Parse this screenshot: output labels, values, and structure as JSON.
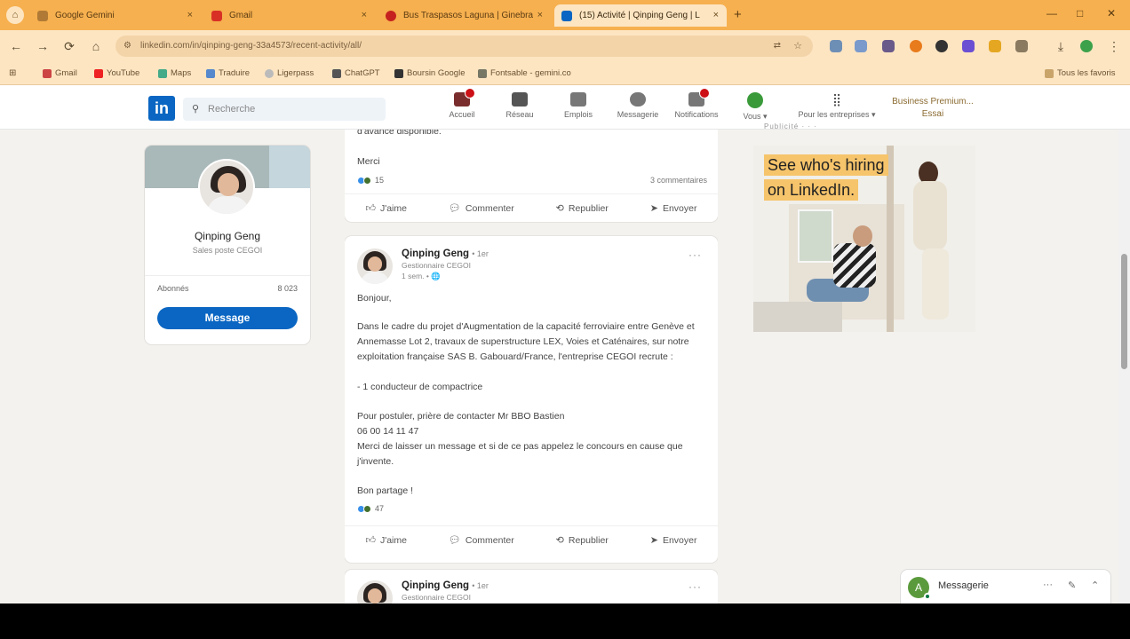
{
  "browser": {
    "tabs": [
      {
        "title": "Google Gemini",
        "color": "#8a6a30"
      },
      {
        "title": "Gmail",
        "color": "#d93025"
      },
      {
        "title": "Bus Traspasos Laguna | Ginebra",
        "color": "#c5221f"
      },
      {
        "title": "(15) Activité | Qinping Geng | L",
        "color": "#0a66c2"
      }
    ],
    "new_tab_label": "+",
    "close_glyph": "×",
    "window_controls": [
      "—",
      "□",
      "✕"
    ],
    "address": "linkedin.com/in/qinping-geng-33a4573/recent-activity/all/",
    "bookmarks": [
      {
        "label": "Gmail",
        "icon": "mail-icon"
      },
      {
        "label": "YouTube",
        "icon": "youtube-icon"
      },
      {
        "label": "Maps",
        "icon": "map-pin-icon"
      },
      {
        "label": "Traduire",
        "icon": "translate-icon"
      },
      {
        "label": "Ligerpass",
        "icon": "globe-icon"
      },
      {
        "label": "ChatGPT",
        "icon": "chat-icon"
      },
      {
        "label": "Boursin Google",
        "icon": "bookmark-icon"
      },
      {
        "label": "Fontsable - gemini.co",
        "icon": "folder-icon"
      }
    ],
    "all_bookmarks": "Tous les favoris",
    "nav_glyphs": {
      "back": "←",
      "forward": "→",
      "reload": "⟳",
      "home": "⌂",
      "download": "⤓"
    }
  },
  "linkedin": {
    "logo": "in",
    "search_placeholder": "Recherche",
    "search_glyph": "⚲",
    "nav": [
      {
        "label": "Accueil",
        "icon": "home-icon",
        "badge": true,
        "color": "#7a2d2d"
      },
      {
        "label": "Réseau",
        "icon": "network-icon",
        "badge": false,
        "color": "#555"
      },
      {
        "label": "Emplois",
        "icon": "briefcase-icon",
        "badge": false,
        "color": "#666"
      },
      {
        "label": "Messagerie",
        "icon": "message-icon",
        "badge": false,
        "color": "#666"
      },
      {
        "label": "Notifications",
        "icon": "bell-icon",
        "badge": true,
        "color": "#666"
      },
      {
        "label": "Vous ▾",
        "icon": "me-avatar-icon",
        "badge": false,
        "color": "#3a8a3a"
      },
      {
        "label": "Pour les entreprises ▾",
        "icon": "grid-icon",
        "badge": false,
        "color": "#555"
      }
    ],
    "trial": {
      "line1": "Business Premium...",
      "line2": "Essai"
    },
    "profile": {
      "name": "Qinping Geng",
      "subtitle": "Sales poste CEGOI",
      "stat_label": "Abonnés",
      "stat_value": "8 023",
      "message_button": "Message"
    },
    "feed": {
      "top_fragment": "d'avance disponible.",
      "top_merci": "Merci",
      "top_reactions": "15",
      "top_comments": "3 commentaires",
      "actions": [
        {
          "label": "J'aime",
          "icon": "like-icon",
          "glyph": "👍︎"
        },
        {
          "label": "Commenter",
          "icon": "comment-icon",
          "glyph": "💬︎"
        },
        {
          "label": "Republier",
          "icon": "repost-icon",
          "glyph": "⟲"
        },
        {
          "label": "Envoyer",
          "icon": "send-icon",
          "glyph": "➤"
        }
      ],
      "post": {
        "author": "Qinping Geng",
        "degree": "• 1er",
        "headline": "Gestionnaire CEGOI",
        "time": "1 sem. • 🌐",
        "more": "···",
        "greeting": "Bonjour,",
        "body1": "Dans le cadre du projet d'Augmentation de la capacité ferroviaire entre Genève et Annemasse Lot 2, travaux de superstructure LEX, Voies et Caténaires, sur notre exploitation française SAS B. Gabouard/France, l'entreprise CEGOI recrute :",
        "body2": "- 1 conducteur de compactrice",
        "body3": "Pour postuler, prière de contacter Mr BBO Bastien",
        "body4": "06 00 14 11 47",
        "body5": "Merci de laisser un message et si de ce pas appelez le concours en cause que j'invente.",
        "signoff": "Bon partage !",
        "reactions": "47"
      },
      "next_author": "Qinping Geng",
      "next_degree": "• 1er",
      "next_headline": "Gestionnaire CEGOI"
    },
    "ad": {
      "top_label": "Publicité · · ·",
      "line1": "See who's hiring",
      "line2": "on LinkedIn."
    },
    "messaging": {
      "label": "Messagerie",
      "avatar": "A",
      "more_glyph": "···",
      "compose_glyph": "✎",
      "collapse_glyph": "⌃"
    }
  }
}
